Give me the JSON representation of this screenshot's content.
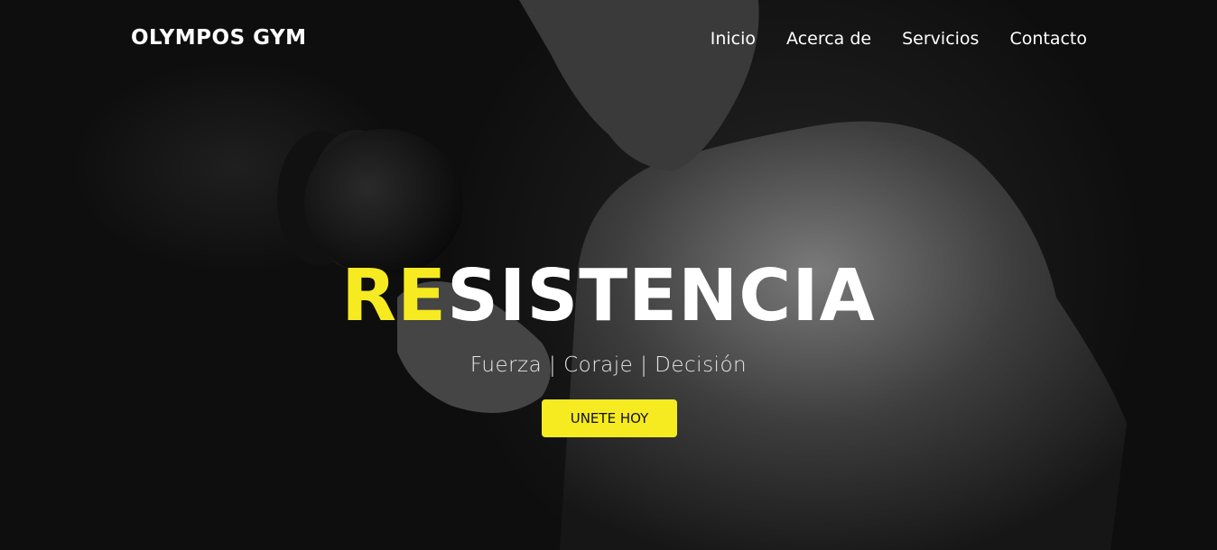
{
  "brand": {
    "name": "OLYMPOS GYM"
  },
  "nav": {
    "items": [
      {
        "label": "Inicio"
      },
      {
        "label": "Acerca de"
      },
      {
        "label": "Servicios"
      },
      {
        "label": "Contacto"
      }
    ]
  },
  "hero": {
    "title_highlight": "RE",
    "title_rest": "SISTENCIA",
    "subtitle": "Fuerza | Coraje | Decisión",
    "cta_label": "UNETE HOY"
  },
  "colors": {
    "accent": "#f6ea21",
    "background": "#0e0e0e",
    "text": "#ffffff"
  }
}
